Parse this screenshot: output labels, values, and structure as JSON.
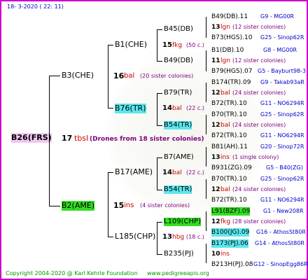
{
  "header": {
    "date": "18-  3-2020 ( 22: 11)"
  },
  "footer": {
    "copyright": "Copyright 2004-2020 @ Karl Kehrle Foundation",
    "site": "www.pedigreeapis.org"
  },
  "root": {
    "id": "B26(FRS)",
    "count": "17",
    "sisters": "tbsl",
    "note": "(Drones from 18 sister colonies)"
  },
  "gen1": [
    {
      "id": "B3(CHE)",
      "count": "16",
      "sisters": "bal",
      "note": "(20 sister colonies)"
    },
    {
      "id": "B2(AME)",
      "count": "15",
      "sisters": "ins",
      "note": "(4 sister colonies)"
    }
  ],
  "gen2": [
    {
      "id": "B1(CHE)",
      "count": "15",
      "sisters": "fkg",
      "note": "(50 c.)"
    },
    {
      "id": "B76(TR)",
      "count": "14",
      "sisters": "bal",
      "note": "(22 c.)"
    },
    {
      "id": "B17(AME)",
      "count": "14",
      "sisters": "bal",
      "note": "(22 c.)"
    },
    {
      "id": "L185(CHP)",
      "count": "13",
      "sisters": "hbg",
      "note": "(18 c.)"
    }
  ],
  "gen3": [
    {
      "id": "B45(DB)",
      "count": "13",
      "sisters": "lgn",
      "note": "(12 sister colonies)"
    },
    {
      "id": "B49(DB)",
      "count": "11",
      "sisters": "lgn",
      "note": "(12 sister colonies)"
    },
    {
      "id": "B79(TR)",
      "count": "12",
      "sisters": "bal",
      "note": "(24 sister colonies)"
    },
    {
      "id": "B54(TR)",
      "count": "12",
      "sisters": "bal",
      "note": "(24 sister colonies)"
    },
    {
      "id": "B7(AME)",
      "count": "13",
      "sisters": "ins",
      "note": "(1 single colony)"
    },
    {
      "id": "B54(TR)",
      "count": "12",
      "sisters": "bal",
      "note": "(24 sister colonies)"
    },
    {
      "id": "L109(CHP)",
      "count": "12",
      "sisters": "fkg",
      "note": "(28 sister colonies)"
    },
    {
      "id": "B235(PJ)",
      "count": "10",
      "sisters": "ins",
      "note": ""
    }
  ],
  "gen4": [
    {
      "id": "B49(DB).11",
      "info": "G9 - MG00R"
    },
    {
      "id": "B73(HGS).10",
      "info": "G25 - Sinop62R"
    },
    {
      "id": "B1(DB).10",
      "info": "G8 - MG00R"
    },
    {
      "id": "B79(HGS).07",
      "info": "G5 - Bayburt98-3"
    },
    {
      "id": "B174(TR).09",
      "info": "G9 - Takab93aR"
    },
    {
      "id": "B72(TR).10",
      "info": "G11 - NO6294R"
    },
    {
      "id": "B70(TR).10",
      "info": "G25 - Sinop62R"
    },
    {
      "id": "B72(TR).10",
      "info": "G11 - NO6294R"
    },
    {
      "id": "B81(AH).11",
      "info": "G20 - Sinop72R"
    },
    {
      "id": "B931(ZG).09",
      "info": "G5 - B40(ZG)"
    },
    {
      "id": "B70(TR).10",
      "info": "G25 - Sinop62R"
    },
    {
      "id": "B72(TR).10",
      "info": "G11 - NO6294R"
    },
    {
      "id": "L91(BZF).09",
      "info": "G1 - New208R"
    },
    {
      "id": "B100(JG).09",
      "info": "G16 - AthosSt80R"
    },
    {
      "id": "B173(PJ).06",
      "info": "G14 - AthosSt80R"
    },
    {
      "id": "B213H(PJ).08",
      "info": "G12 - SinopEgg86R"
    }
  ]
}
